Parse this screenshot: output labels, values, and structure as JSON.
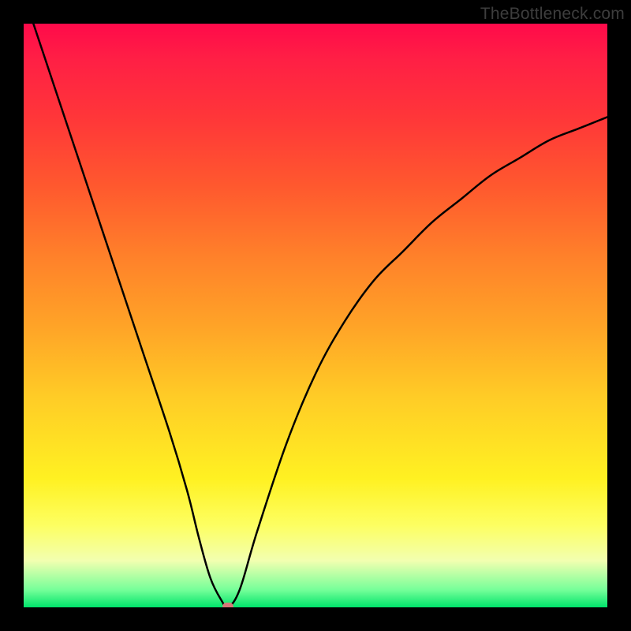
{
  "branding": "TheBottleneck.com",
  "chart_data": {
    "type": "line",
    "title": "",
    "xlabel": "",
    "ylabel": "",
    "series": [
      {
        "name": "bottleneck-curve",
        "x": [
          0.0,
          0.05,
          0.1,
          0.15,
          0.2,
          0.25,
          0.28,
          0.3,
          0.32,
          0.34,
          0.35,
          0.37,
          0.4,
          0.45,
          0.5,
          0.55,
          0.6,
          0.65,
          0.7,
          0.75,
          0.8,
          0.85,
          0.9,
          0.95,
          1.0
        ],
        "values": [
          1.05,
          0.9,
          0.75,
          0.6,
          0.45,
          0.3,
          0.2,
          0.12,
          0.05,
          0.01,
          0.0,
          0.03,
          0.13,
          0.28,
          0.4,
          0.49,
          0.56,
          0.61,
          0.66,
          0.7,
          0.74,
          0.77,
          0.8,
          0.82,
          0.84
        ]
      }
    ],
    "xlim": [
      0,
      1
    ],
    "ylim": [
      0,
      1
    ],
    "optimal_point": {
      "x": 0.35,
      "y": 0.0
    },
    "gradient_stops": [
      {
        "pos": 0.0,
        "color": "#ff0a4a"
      },
      {
        "pos": 0.5,
        "color": "#ffb027"
      },
      {
        "pos": 0.8,
        "color": "#fff122"
      },
      {
        "pos": 1.0,
        "color": "#00e46b"
      }
    ]
  }
}
